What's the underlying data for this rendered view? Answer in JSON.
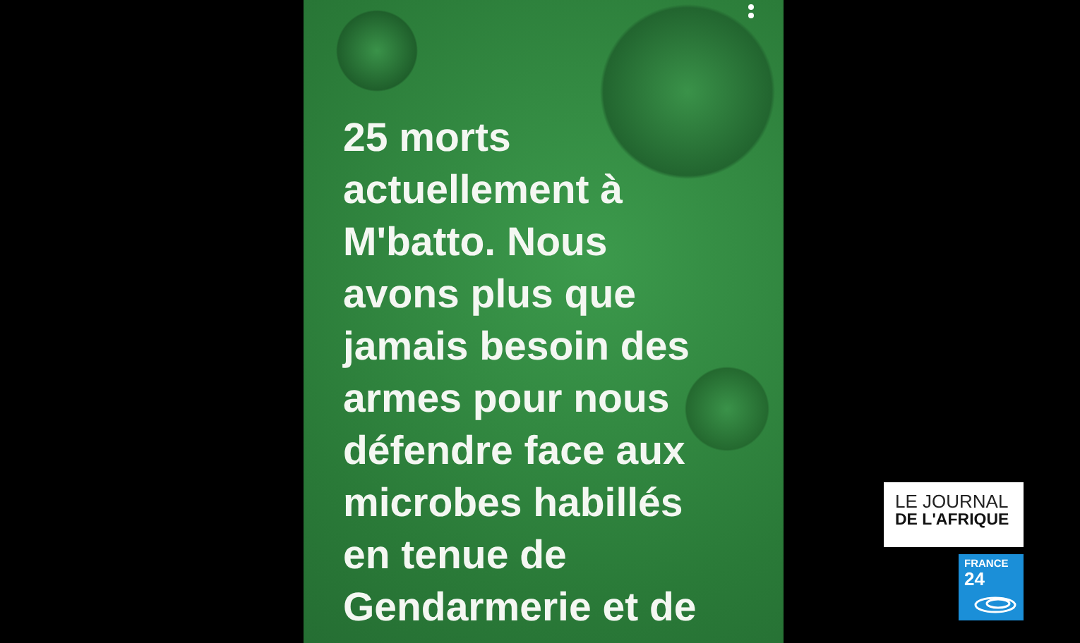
{
  "post": {
    "text": "25 morts actuellement à M'batto. Nous avons plus que jamais besoin des armes pour nous défendre face aux microbes habillés en tenue de Gendarmerie et de"
  },
  "show_logo": {
    "line_1": "LE JOURNAL",
    "line_2": "DE L'AFRIQUE"
  },
  "channel_logo": {
    "line_1": "FRANCE",
    "line_2": "24"
  }
}
